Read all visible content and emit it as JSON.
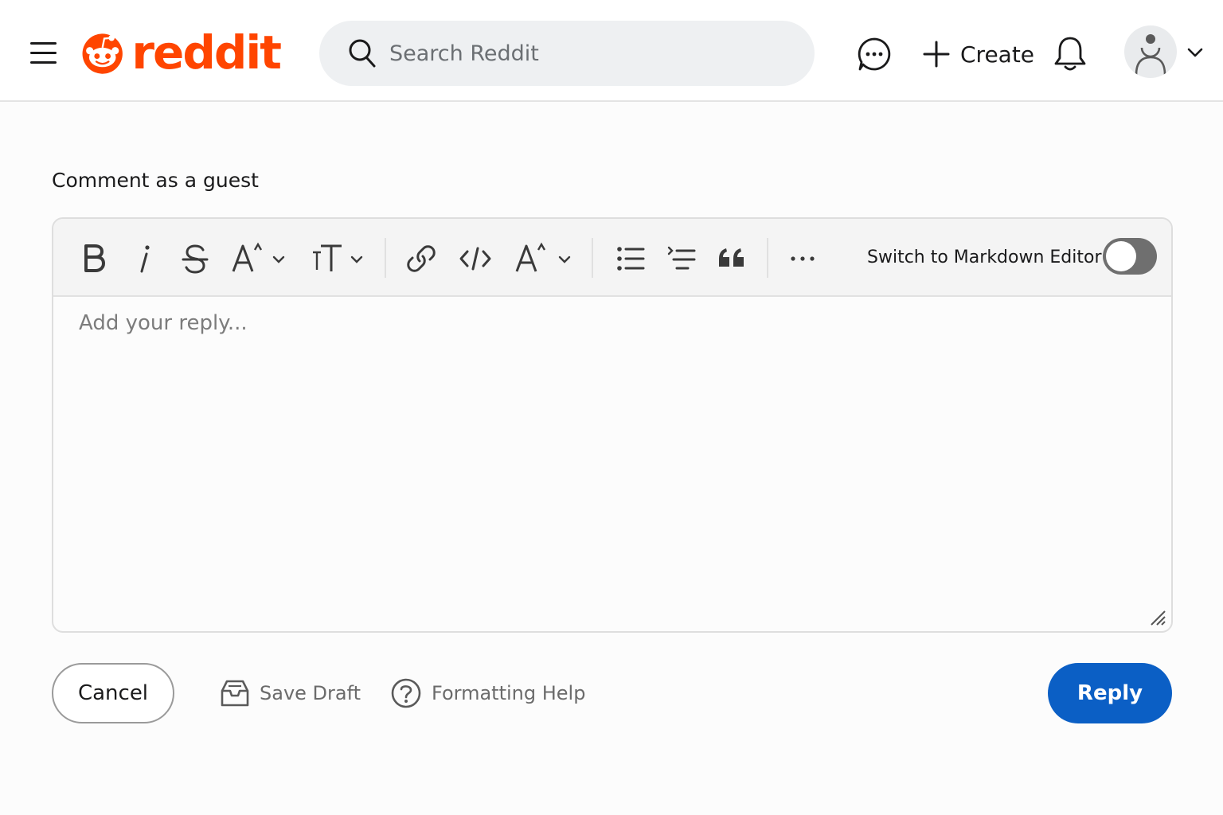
{
  "brand": {
    "wordmark": "reddit",
    "color": "#ff4500"
  },
  "header": {
    "search": {
      "placeholder": "Search Reddit",
      "value": ""
    },
    "create_label": "Create",
    "icons": [
      "menu-icon",
      "search-icon",
      "chat-icon",
      "plus-icon",
      "bell-icon",
      "user-avatar-icon",
      "chevron-down-icon"
    ]
  },
  "comment": {
    "label": "Comment as a guest",
    "placeholder": "Add your reply...",
    "value": "",
    "markdown_toggle": {
      "label": "Switch to Markdown Editor",
      "on": false
    },
    "toolbar": [
      "bold-icon",
      "italic-icon",
      "strikethrough-icon",
      "superscript-icon",
      "text-size-icon",
      "link-icon",
      "code-icon",
      "superscript-alt-icon",
      "bulleted-list-icon",
      "numbered-list-icon",
      "quote-icon",
      "more-icon"
    ]
  },
  "footer": {
    "cancel_label": "Cancel",
    "save_draft_label": "Save Draft",
    "formatting_help_label": "Formatting Help",
    "reply_label": "Reply"
  },
  "colors": {
    "reply_button": "#0b5fc5",
    "toggle_off": "#6f6f6f",
    "toolbar_bg": "#f4f4f4"
  }
}
